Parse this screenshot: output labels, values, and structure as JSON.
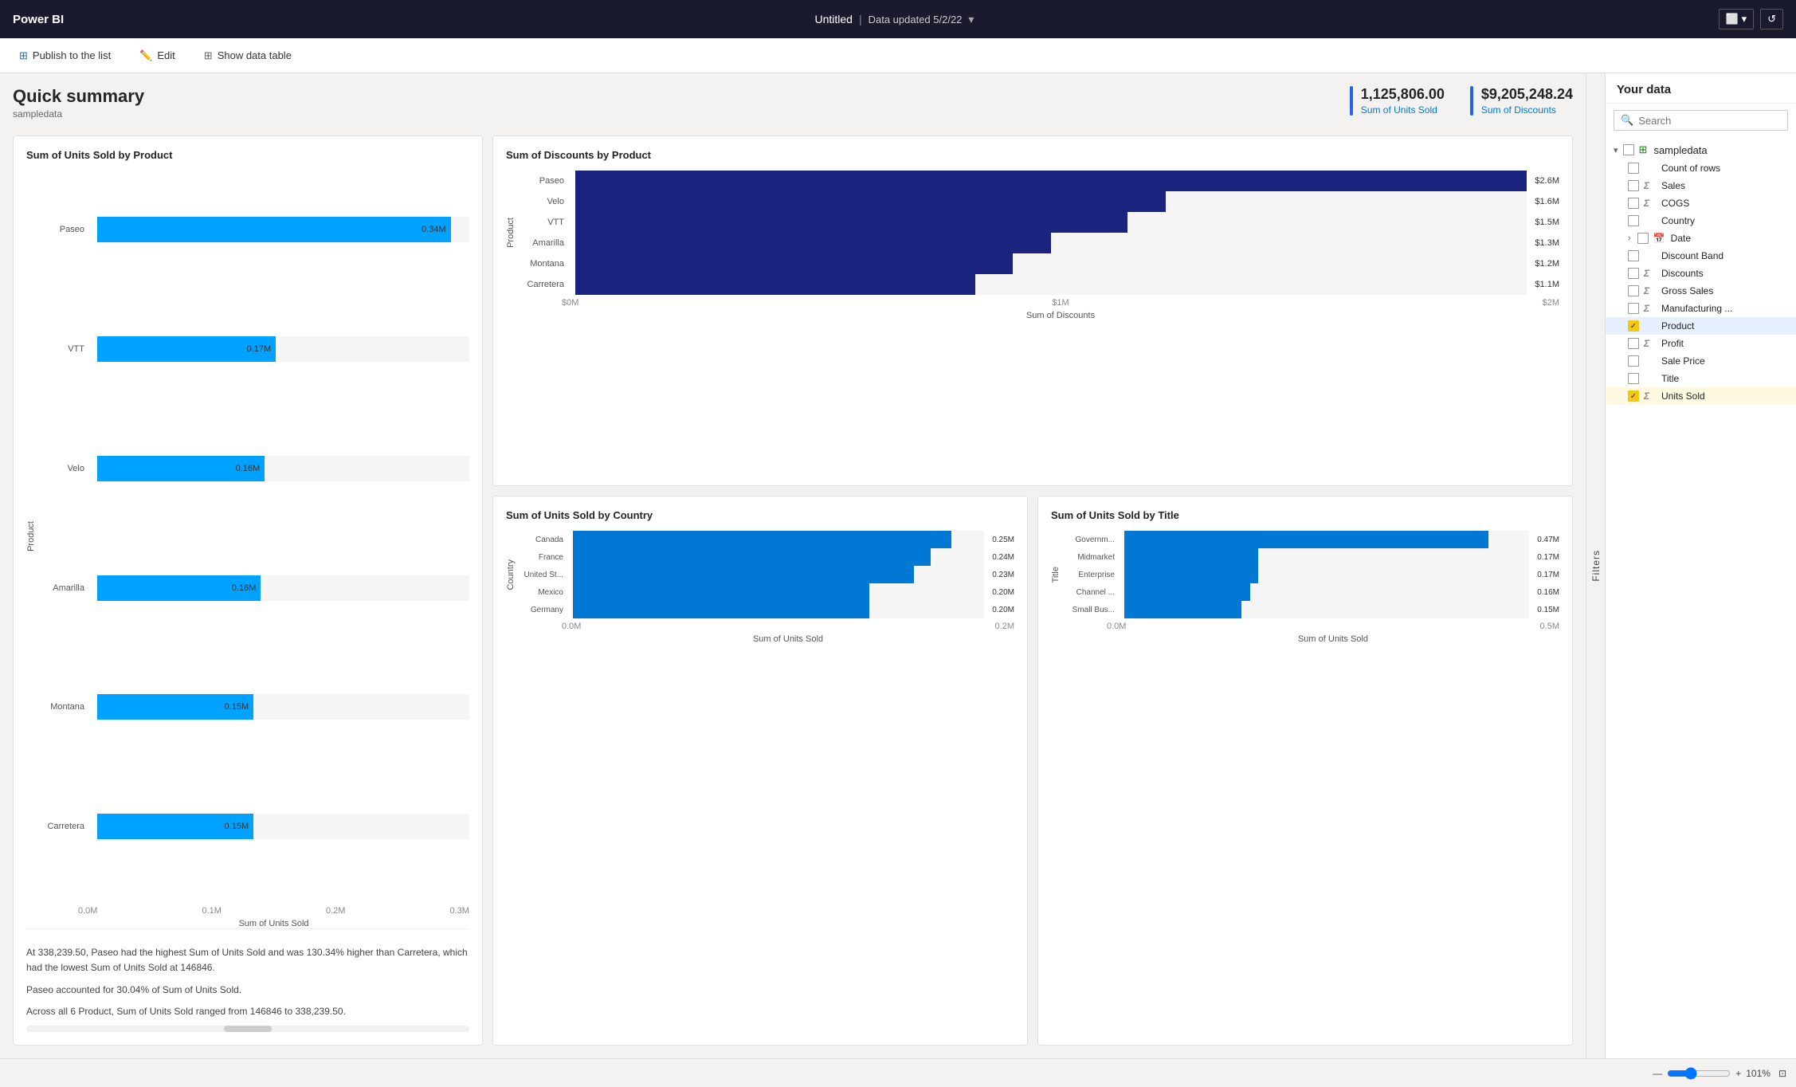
{
  "topbar": {
    "logo": "Power BI",
    "title": "Untitled",
    "subtitle": "Data updated 5/2/22",
    "chevron": "▾"
  },
  "toolbar": {
    "publish_label": "Publish to the list",
    "edit_label": "Edit",
    "show_data_label": "Show data table"
  },
  "summary": {
    "title": "Quick summary",
    "datasource": "sampledata",
    "kpi1_value": "1,125,806.00",
    "kpi1_label": "Sum of Units Sold",
    "kpi2_value": "$9,205,248.24",
    "kpi2_label": "Sum of Discounts"
  },
  "chart_units_by_product": {
    "title": "Sum of Units Sold by Product",
    "y_label": "Product",
    "x_label": "Sum of Units Sold",
    "x_ticks": [
      "0.0M",
      "0.1M",
      "0.2M",
      "0.3M"
    ],
    "bars": [
      {
        "label": "Paseo",
        "value": "0.34M",
        "pct": 95
      },
      {
        "label": "VTT",
        "value": "0.17M",
        "pct": 48
      },
      {
        "label": "Velo",
        "value": "0.16M",
        "pct": 45
      },
      {
        "label": "Amarilla",
        "value": "0.16M",
        "pct": 44
      },
      {
        "label": "Montana",
        "value": "0.15M",
        "pct": 42
      },
      {
        "label": "Carretera",
        "value": "0.15M",
        "pct": 42
      }
    ],
    "bar_color": "#00a2ff",
    "insight1": "At 338,239.50, Paseo had the highest Sum of Units Sold and was 130.34% higher than Carretera, which had the lowest Sum of Units Sold at 146846.",
    "insight2": "Paseo accounted for 30.04% of Sum of Units Sold.",
    "insight3": "Across all 6 Product, Sum of Units Sold ranged from 146846 to 338,239.50."
  },
  "chart_discounts_by_product": {
    "title": "Sum of Discounts by Product",
    "y_label": "Product",
    "x_label": "Sum of Discounts",
    "x_ticks": [
      "$0M",
      "$1M",
      "$2M"
    ],
    "bars": [
      {
        "label": "Paseo",
        "value": "$2.6M",
        "pct": 100
      },
      {
        "label": "Velo",
        "value": "$1.6M",
        "pct": 62
      },
      {
        "label": "VTT",
        "value": "$1.5M",
        "pct": 58
      },
      {
        "label": "Amarilla",
        "value": "$1.3M",
        "pct": 50
      },
      {
        "label": "Montana",
        "value": "$1.2M",
        "pct": 46
      },
      {
        "label": "Carretera",
        "value": "$1.1M",
        "pct": 42
      }
    ],
    "bar_color": "#1a237e"
  },
  "chart_units_by_country": {
    "title": "Sum of Units Sold by Country",
    "y_label": "Country",
    "x_label": "Sum of Units Sold",
    "x_ticks": [
      "0.0M",
      "0.2M"
    ],
    "bars": [
      {
        "label": "Canada",
        "value": "0.25M",
        "pct": 92
      },
      {
        "label": "France",
        "value": "0.24M",
        "pct": 87
      },
      {
        "label": "United St...",
        "value": "0.23M",
        "pct": 83
      },
      {
        "label": "Mexico",
        "value": "0.20M",
        "pct": 72
      },
      {
        "label": "Germany",
        "value": "0.20M",
        "pct": 72
      }
    ],
    "bar_color": "#0078d4"
  },
  "chart_units_by_title": {
    "title": "Sum of Units Sold by Title",
    "y_label": "Title",
    "x_label": "Sum of Units Sold",
    "x_ticks": [
      "0.0M",
      "0.5M"
    ],
    "bars": [
      {
        "label": "Governm...",
        "value": "0.47M",
        "pct": 90
      },
      {
        "label": "Midmarket",
        "value": "0.17M",
        "pct": 33
      },
      {
        "label": "Enterprise",
        "value": "0.17M",
        "pct": 33
      },
      {
        "label": "Channel ...",
        "value": "0.16M",
        "pct": 31
      },
      {
        "label": "Small Bus...",
        "value": "0.15M",
        "pct": 29
      }
    ],
    "bar_color": "#0078d4"
  },
  "sidebar": {
    "header": "Your data",
    "search_placeholder": "Search",
    "filters_label": "Filters",
    "tree": {
      "parent_label": "sampledata",
      "children": [
        {
          "id": "count-of-rows",
          "label": "Count of rows",
          "icon": "none",
          "checked": false,
          "highlighted": false
        },
        {
          "id": "sales",
          "label": "Sales",
          "icon": "sigma",
          "checked": false,
          "highlighted": false
        },
        {
          "id": "cogs",
          "label": "COGS",
          "icon": "sigma",
          "checked": false,
          "highlighted": false
        },
        {
          "id": "country",
          "label": "Country",
          "icon": "none",
          "checked": false,
          "highlighted": false
        },
        {
          "id": "date",
          "label": "Date",
          "icon": "calendar",
          "checked": false,
          "highlighted": false,
          "expandable": true
        },
        {
          "id": "discount-band",
          "label": "Discount Band",
          "icon": "none",
          "checked": false,
          "highlighted": false
        },
        {
          "id": "discounts",
          "label": "Discounts",
          "icon": "sigma",
          "checked": false,
          "highlighted": false
        },
        {
          "id": "gross-sales",
          "label": "Gross Sales",
          "icon": "sigma",
          "checked": false,
          "highlighted": false
        },
        {
          "id": "manufacturing",
          "label": "Manufacturing ...",
          "icon": "sigma",
          "checked": false,
          "highlighted": false
        },
        {
          "id": "product",
          "label": "Product",
          "icon": "none",
          "checked": true,
          "highlighted": true
        },
        {
          "id": "profit",
          "label": "Profit",
          "icon": "sigma",
          "checked": false,
          "highlighted": false
        },
        {
          "id": "sale-price",
          "label": "Sale Price",
          "icon": "none",
          "checked": false,
          "highlighted": false
        },
        {
          "id": "title",
          "label": "Title",
          "icon": "none",
          "checked": false,
          "highlighted": false
        },
        {
          "id": "units-sold",
          "label": "Units Sold",
          "icon": "sigma",
          "checked": true,
          "highlighted": true,
          "yellow": true
        }
      ]
    }
  },
  "bottombar": {
    "zoom": "101%",
    "fit_icon": "⊡"
  },
  "icons": {
    "publish": "📤",
    "edit": "✏️",
    "table": "📋",
    "search": "🔍",
    "window": "⬜",
    "refresh": "↺",
    "collapse": "⟨",
    "table_data": "⊞"
  }
}
